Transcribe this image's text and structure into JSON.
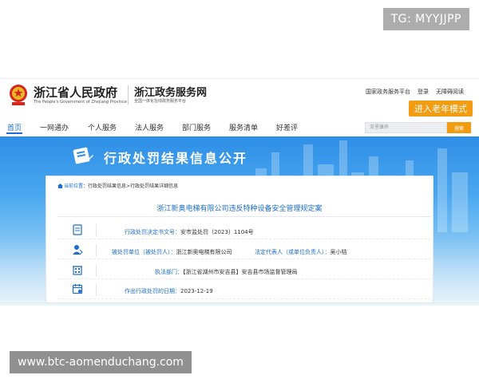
{
  "watermark": {
    "top": "TG: MYYJJPP",
    "bottom": "www.btc-aomenduchang.com"
  },
  "header": {
    "gov_name": "浙江省人民政府",
    "gov_sub": "The People's Government of Zhejiang Province",
    "portal_name": "浙江政务服务网",
    "portal_sub": "全国一体化在线政务服务平台",
    "links": {
      "national": "国家政务服务平台",
      "login": "登录",
      "accessible": "无障碍阅读"
    },
    "elder_mode": "进入老年模式"
  },
  "nav": {
    "items": [
      "首页",
      "一网通办",
      "个人服务",
      "法人服务",
      "部门服务",
      "服务清单",
      "好差评"
    ],
    "active": "首页",
    "search_placeholder": "浙里康养",
    "search_button": "搜索"
  },
  "banner": {
    "title": "行政处罚结果信息公开"
  },
  "breadcrumb": {
    "here": "当前位置",
    "colon": "：",
    "crumb1": "行政处罚结果信息",
    "sep": ">",
    "crumb2": "行政处罚结果详细信息"
  },
  "record": {
    "title": "浙江新奥电梯有限公司违反特种设备安全管理规定案",
    "doc_no_label": "行政处罚决定书文号：",
    "doc_no": "安市监处罚〔2023〕1104号",
    "party_label": "被处罚单位（被处罚人）：",
    "party": "浙江新奥电梯有限公司",
    "rep_label": "法定代表人（或单位负责人）：",
    "rep": "吴小桔",
    "dept_label": "执法部门：",
    "dept": "【浙江省湖州市安吉县】安吉县市场监督管理局",
    "date_label": "作出行政处罚的日期：",
    "date": "2023-12-19"
  },
  "icons": {
    "emblem": "national-emblem-icon",
    "banner": "book-icon",
    "row1": "document-icon",
    "row2": "person-icon",
    "row3": "building-icon",
    "row4": "calendar-icon"
  },
  "colors": {
    "accent": "#1c6fd1",
    "orange": "#f39c12",
    "banner_top": "#2e8ee6"
  }
}
